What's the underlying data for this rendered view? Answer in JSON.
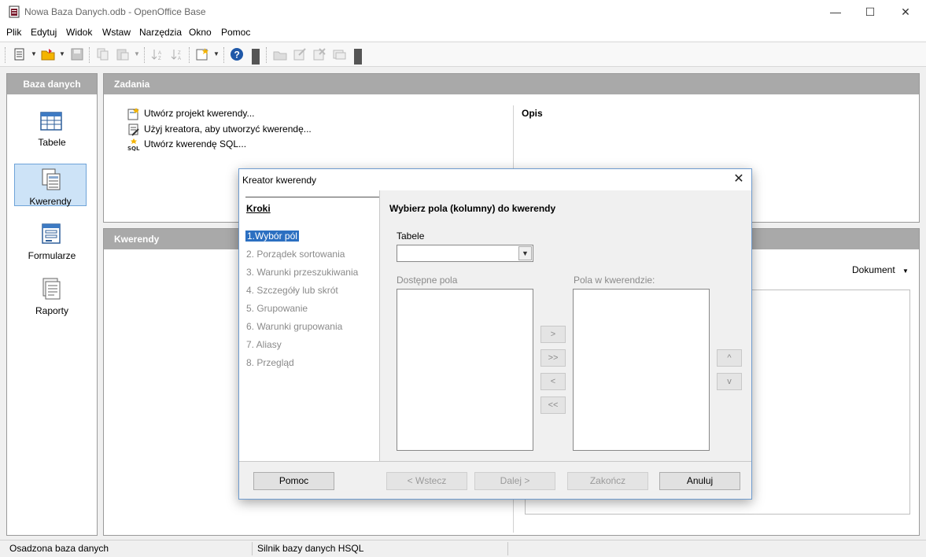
{
  "window": {
    "title": "Nowa Baza Danych.odb - OpenOffice Base",
    "min": "—",
    "max": "☐",
    "close": "✕"
  },
  "menu": [
    "Plik",
    "Edytuj",
    "Widok",
    "Wstaw",
    "Narzędzia",
    "Okno",
    "Pomoc"
  ],
  "left_panel": {
    "title": "Baza danych",
    "items": [
      "Tabele",
      "Kwerendy",
      "Formularze",
      "Raporty"
    ],
    "active": "Kwerendy"
  },
  "tasks": {
    "title": "Zadania",
    "items": [
      "Utwórz projekt kwerendy...",
      "Użyj kreatora, aby utworzyć kwerendę...",
      "Utwórz kwerendę SQL..."
    ],
    "description_title": "Opis"
  },
  "queries": {
    "title": "Kwerendy",
    "preview_mode": "Dokument"
  },
  "status": {
    "left": "Osadzona baza danych",
    "middle": "Silnik bazy danych HSQL"
  },
  "dialog": {
    "title": "Kreator kwerendy",
    "steps_title": "Kroki",
    "steps": [
      "1.Wybór pól",
      "2. Porządek sortowania",
      "3. Warunki przeszukiwania",
      "4. Szczegóły lub skrót",
      "5. Grupowanie",
      "6. Warunki grupowania",
      "7. Aliasy",
      "8. Przegląd"
    ],
    "heading": "Wybierz pola (kolumny) do kwerendy",
    "tables_label": "Tabele",
    "tables_value": "",
    "available_label": "Dostępne pola",
    "selected_label": "Pola w kwerendzie:",
    "move_buttons": [
      ">",
      ">>",
      "<",
      "<<"
    ],
    "order_buttons": [
      "^",
      "v"
    ],
    "buttons": {
      "help": "Pomoc",
      "back": "< Wstecz",
      "next": "Dalej >",
      "finish": "Zakończ",
      "cancel": "Anuluj"
    }
  },
  "colors": {
    "panel_header": "#a9a9a9",
    "selection": "#2b6fc1",
    "active_item": "#cde3f7"
  }
}
